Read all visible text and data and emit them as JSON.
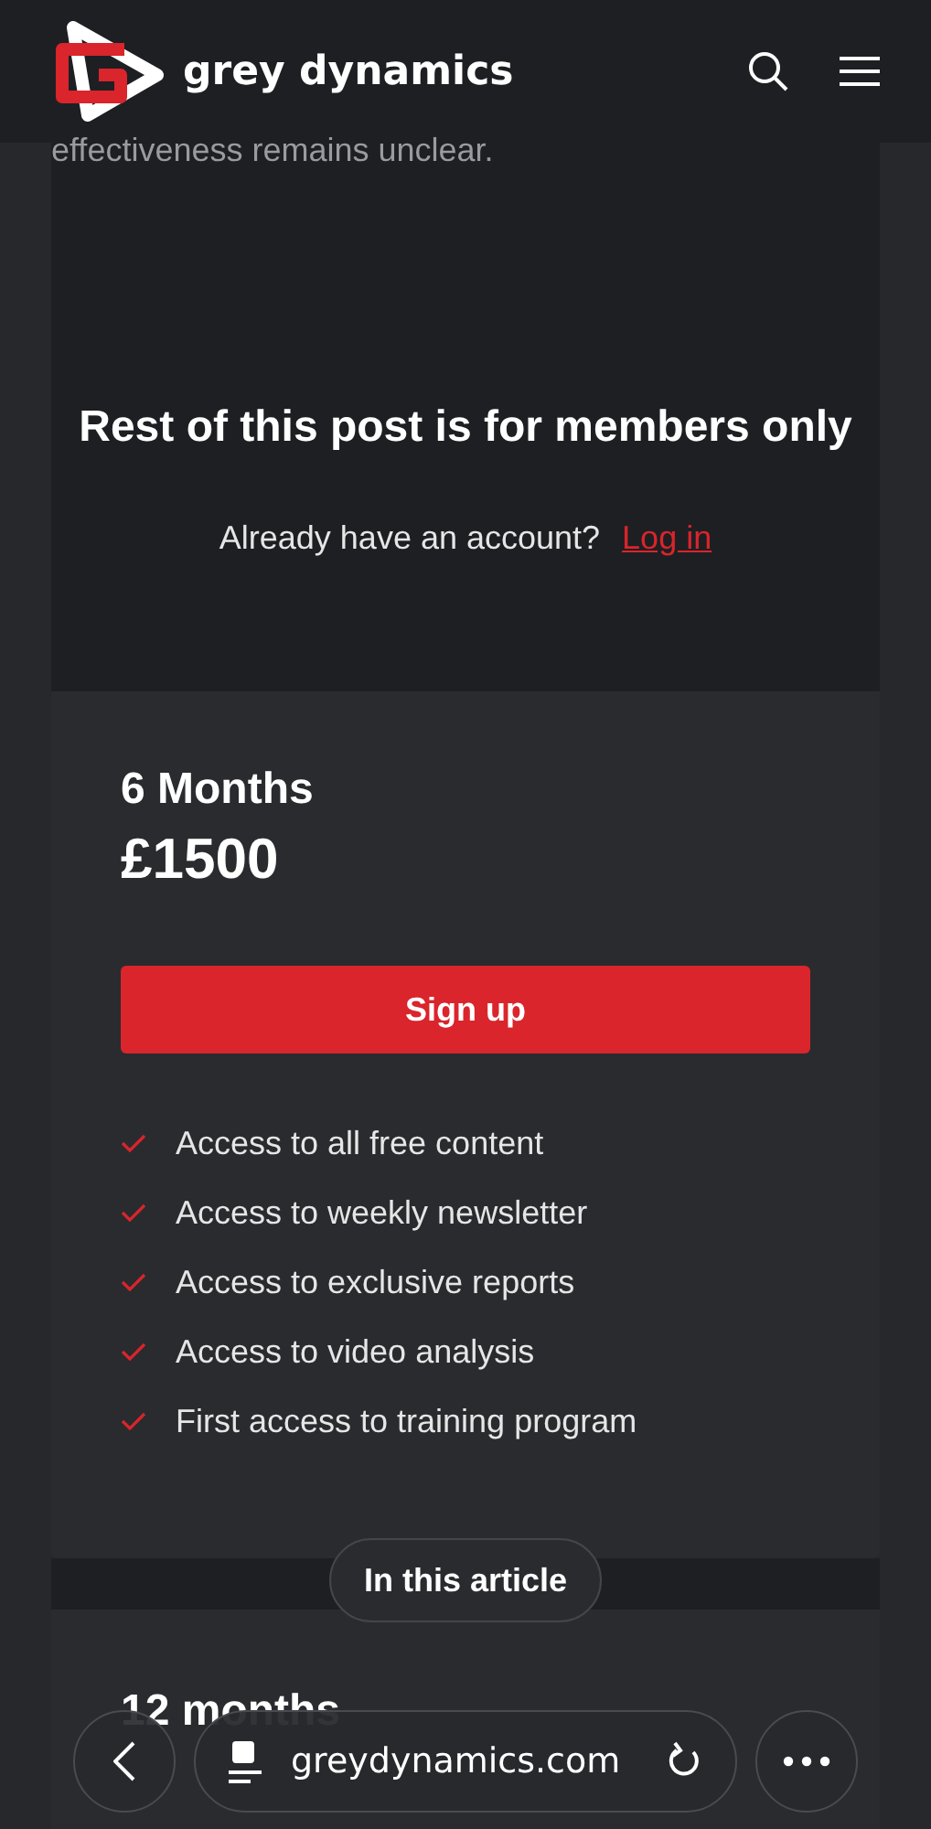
{
  "header": {
    "brand": "grey dynamics"
  },
  "article": {
    "fragment": "effectiveness remains unclear."
  },
  "paywall": {
    "title": "Rest of this post is for members only",
    "prompt": "Already have an account?",
    "login": "Log in"
  },
  "plans": [
    {
      "name": "6 Months",
      "price": "£1500",
      "button": "Sign up",
      "features": [
        "Access to all free content",
        "Access to weekly newsletter",
        "Access to exclusive reports",
        "Access to video analysis",
        "First access to training program"
      ]
    },
    {
      "name": "12 months"
    }
  ],
  "toc_button": "In this article",
  "browser": {
    "url": "greydynamics.com"
  }
}
